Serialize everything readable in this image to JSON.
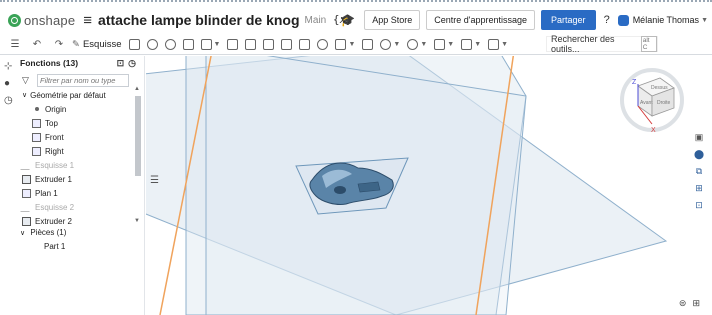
{
  "header": {
    "logo_text": "onshape",
    "doc_title": "attache lampe blinder de knog",
    "branch": "Main",
    "variable_label": "{𝑥}",
    "app_store": "App Store",
    "learning_center": "Centre d'apprentissage",
    "share": "Partager",
    "help_icon": "?",
    "user_name": "Mélanie Thomas"
  },
  "toolbar": {
    "sketch_label": "Esquisse",
    "search_placeholder": "Rechercher des outils...",
    "search_shortcut": "alt C"
  },
  "feature_panel": {
    "title": "Fonctions (13)",
    "filter_placeholder": "Filtrer par nom ou type",
    "tree": [
      {
        "label": "Géométrie par défaut",
        "kind": "group",
        "expanded": true
      },
      {
        "label": "Origin",
        "kind": "origin"
      },
      {
        "label": "Top",
        "kind": "plane"
      },
      {
        "label": "Front",
        "kind": "plane"
      },
      {
        "label": "Right",
        "kind": "plane"
      },
      {
        "label": "Esquisse 1",
        "kind": "sketch",
        "dim": true
      },
      {
        "label": "Extruder 1",
        "kind": "feature"
      },
      {
        "label": "Plan 1",
        "kind": "plane"
      },
      {
        "label": "Esquisse 2",
        "kind": "sketch",
        "dim": true
      },
      {
        "label": "Extruder 2",
        "kind": "feature"
      }
    ],
    "parts_header": "Pièces (1)",
    "parts": [
      "Part 1"
    ]
  },
  "viewcube": {
    "top": "Dessus",
    "front": "Avant",
    "right": "Droite",
    "axes": [
      "Z",
      "X"
    ]
  },
  "colors": {
    "plane_fill": "#dbe6ef",
    "plane_stroke": "#8fb0cc",
    "orange_line": "#f0a35c",
    "part_fill": "#5a84a8",
    "share_button": "#2a6bc4",
    "axis_z": "#4b4bd6",
    "axis_x": "#d63c3c"
  }
}
